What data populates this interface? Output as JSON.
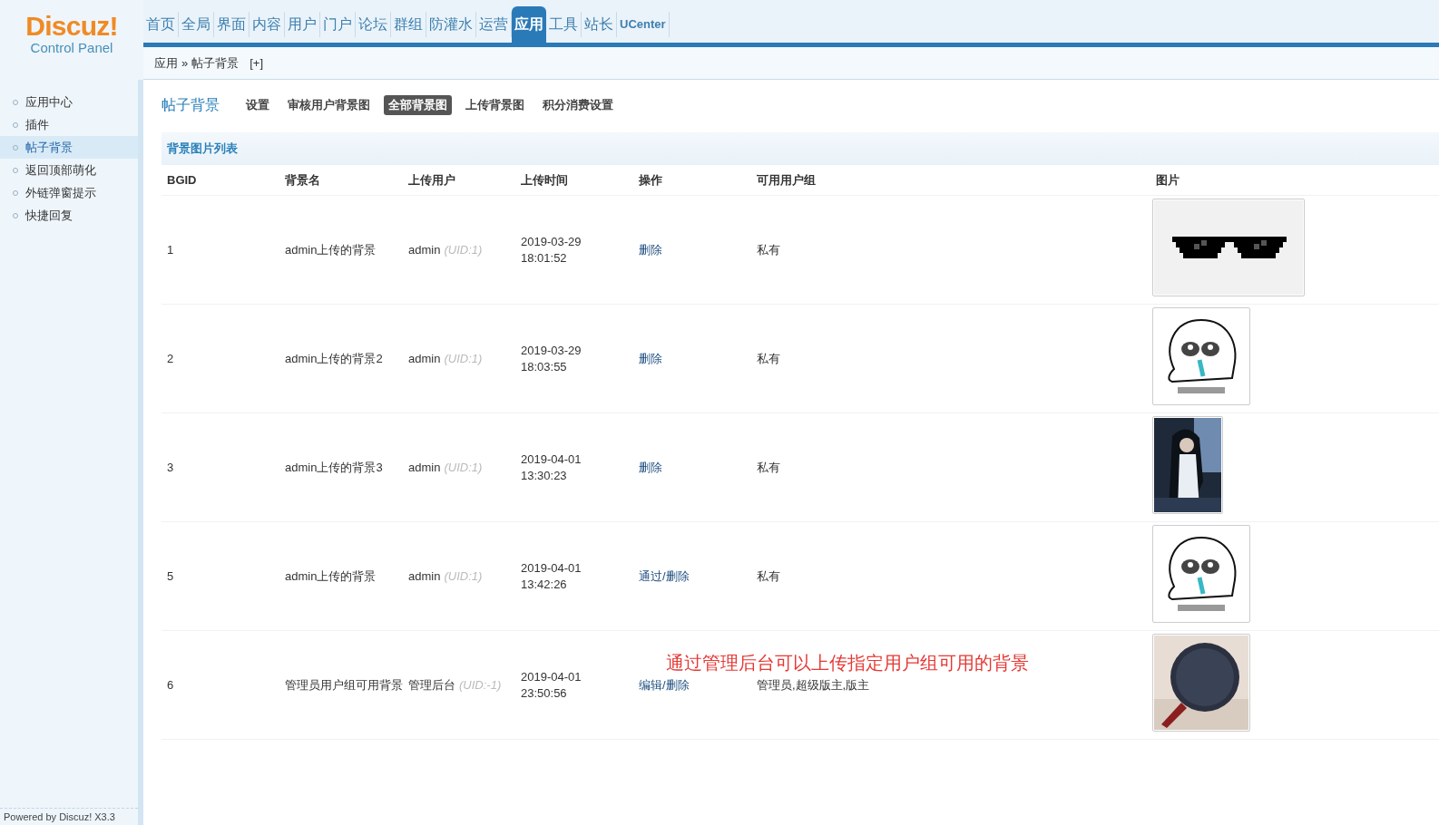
{
  "logo": {
    "name": "Discuz!",
    "subtitle": "Control Panel"
  },
  "nav": [
    {
      "label": "首页",
      "selected": false,
      "kind": "cn"
    },
    {
      "label": "全局",
      "selected": false,
      "kind": "cn"
    },
    {
      "label": "界面",
      "selected": false,
      "kind": "cn"
    },
    {
      "label": "内容",
      "selected": false,
      "kind": "cn"
    },
    {
      "label": "用户",
      "selected": false,
      "kind": "cn"
    },
    {
      "label": "门户",
      "selected": false,
      "kind": "cn"
    },
    {
      "label": "论坛",
      "selected": false,
      "kind": "cn"
    },
    {
      "label": "群组",
      "selected": false,
      "kind": "cn"
    },
    {
      "label": "防灌水",
      "selected": false,
      "kind": "cn"
    },
    {
      "label": "运营",
      "selected": false,
      "kind": "cn"
    },
    {
      "label": "应用",
      "selected": true,
      "kind": "cn"
    },
    {
      "label": "工具",
      "selected": false,
      "kind": "cn"
    },
    {
      "label": "站长",
      "selected": false,
      "kind": "cn"
    },
    {
      "label": "UCenter",
      "selected": false,
      "kind": "en"
    }
  ],
  "breadcrumb": {
    "parent": "应用",
    "separator": "»",
    "current": "帖子背景",
    "add": "[+]"
  },
  "sidebar": {
    "items": [
      {
        "label": "应用中心",
        "selected": false
      },
      {
        "label": "插件",
        "selected": false
      },
      {
        "label": "帖子背景",
        "selected": true
      },
      {
        "label": "返回顶部萌化",
        "selected": false
      },
      {
        "label": "外链弹窗提示",
        "selected": false
      },
      {
        "label": "快捷回复",
        "selected": false
      }
    ],
    "footer": "Powered by Discuz! X3.3"
  },
  "page_title": "帖子背景",
  "subtabs": [
    {
      "label": "设置",
      "selected": false
    },
    {
      "label": "审核用户背景图",
      "selected": false
    },
    {
      "label": "全部背景图",
      "selected": true
    },
    {
      "label": "上传背景图",
      "selected": false
    },
    {
      "label": "积分消费设置",
      "selected": false
    }
  ],
  "table": {
    "title": "背景图片列表",
    "columns": [
      "BGID",
      "背景名",
      "上传用户",
      "上传时间",
      "操作",
      "可用用户组",
      "图片"
    ],
    "rows": [
      {
        "bgid": "1",
        "name": "admin上传的背景",
        "user": "admin",
        "uid": "(UID:1)",
        "date": "2019-03-29",
        "time": "18:01:52",
        "actions": [
          "删除"
        ],
        "groups": "私有"
      },
      {
        "bgid": "2",
        "name": "admin上传的背景2",
        "user": "admin",
        "uid": "(UID:1)",
        "date": "2019-03-29",
        "time": "18:03:55",
        "actions": [
          "删除"
        ],
        "groups": "私有"
      },
      {
        "bgid": "3",
        "name": "admin上传的背景3",
        "user": "admin",
        "uid": "(UID:1)",
        "date": "2019-04-01",
        "time": "13:30:23",
        "actions": [
          "删除"
        ],
        "groups": "私有"
      },
      {
        "bgid": "5",
        "name": "admin上传的背景",
        "user": "admin",
        "uid": "(UID:1)",
        "date": "2019-04-01",
        "time": "13:42:26",
        "actions": [
          "通过",
          "/",
          "删除"
        ],
        "groups": "私有"
      },
      {
        "bgid": "6",
        "name": "管理员用户组可用背景",
        "user": "管理后台",
        "uid": "(UID:-1)",
        "date": "2019-04-01",
        "time": "23:50:56",
        "actions": [
          "编辑",
          "/",
          "删除"
        ],
        "groups": "管理员,超级版主,版主"
      }
    ]
  },
  "annotation": "通过管理后台可以上传指定用户组可用的背景"
}
